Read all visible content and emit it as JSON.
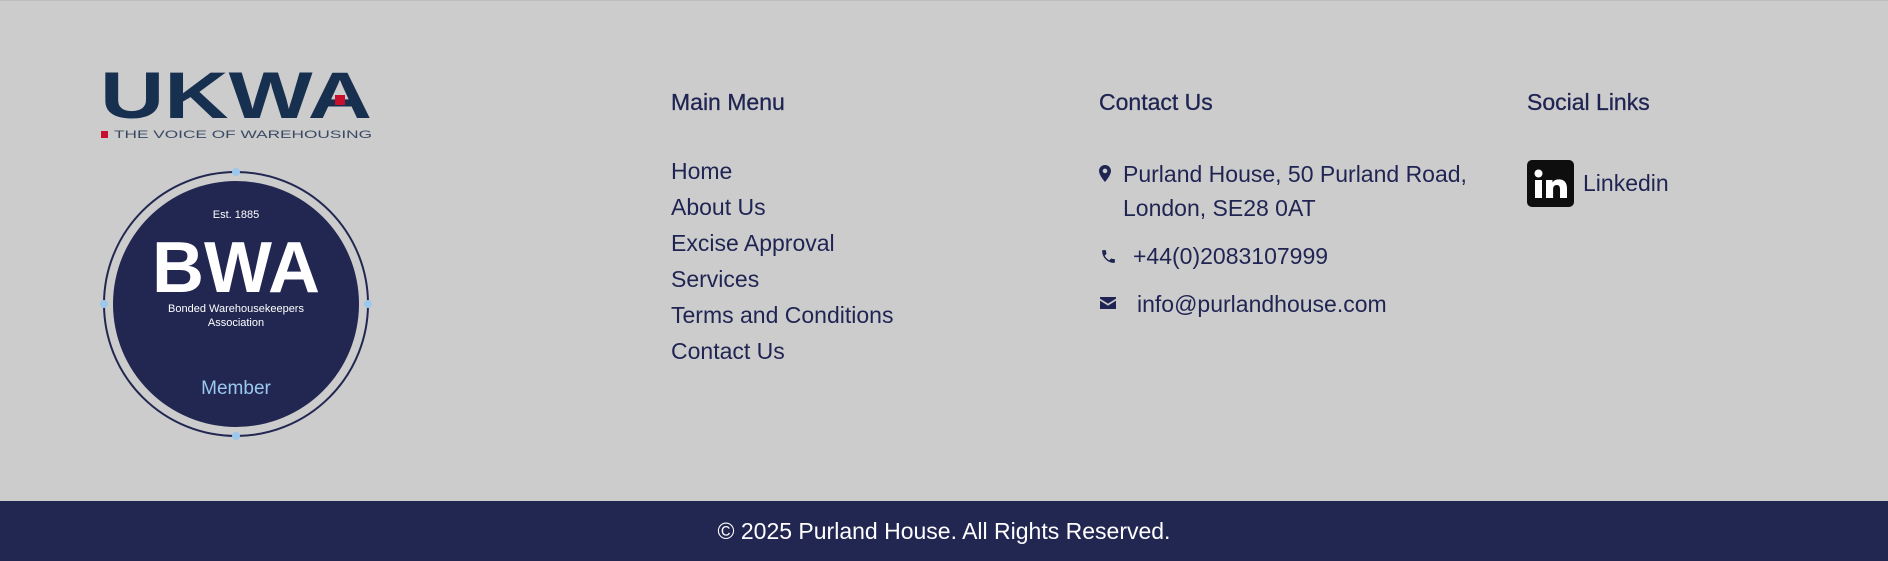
{
  "brand": {
    "ukwa_logo_text": "UKWA",
    "ukwa_tagline": "THE VOICE OF WAREHOUSING",
    "bwa_est": "Est. 1885",
    "bwa_name": "BWA",
    "bwa_full_line1": "Bonded Warehousekeepers",
    "bwa_full_line2": "Association",
    "bwa_member": "Member"
  },
  "main_menu": {
    "heading": "Main Menu",
    "items": [
      {
        "label": "Home"
      },
      {
        "label": "About Us"
      },
      {
        "label": "Excise Approval"
      },
      {
        "label": "Services"
      },
      {
        "label": "Terms and Conditions"
      },
      {
        "label": "Contact Us"
      }
    ]
  },
  "contact": {
    "heading": "Contact Us",
    "address": "Purland House, 50 Purland Road, London, SE28 0AT",
    "phone": "+44(0)2083107999",
    "email": "info@purlandhouse.com",
    "address_icon": "map-pin-icon",
    "phone_icon": "phone-icon",
    "email_icon": "envelope-icon"
  },
  "social": {
    "heading": "Social Links",
    "linkedin_label": "Linkedin",
    "linkedin_icon": "linkedin-icon"
  },
  "copyright": "© 2025 Purland House. All Rights Reserved.",
  "colors": {
    "navy": "#1f2452",
    "footer_bg": "#cccccc",
    "bar_bg": "#222752",
    "ukwa_red": "#c8102e",
    "bwa_light_blue": "#9bc8ec"
  }
}
